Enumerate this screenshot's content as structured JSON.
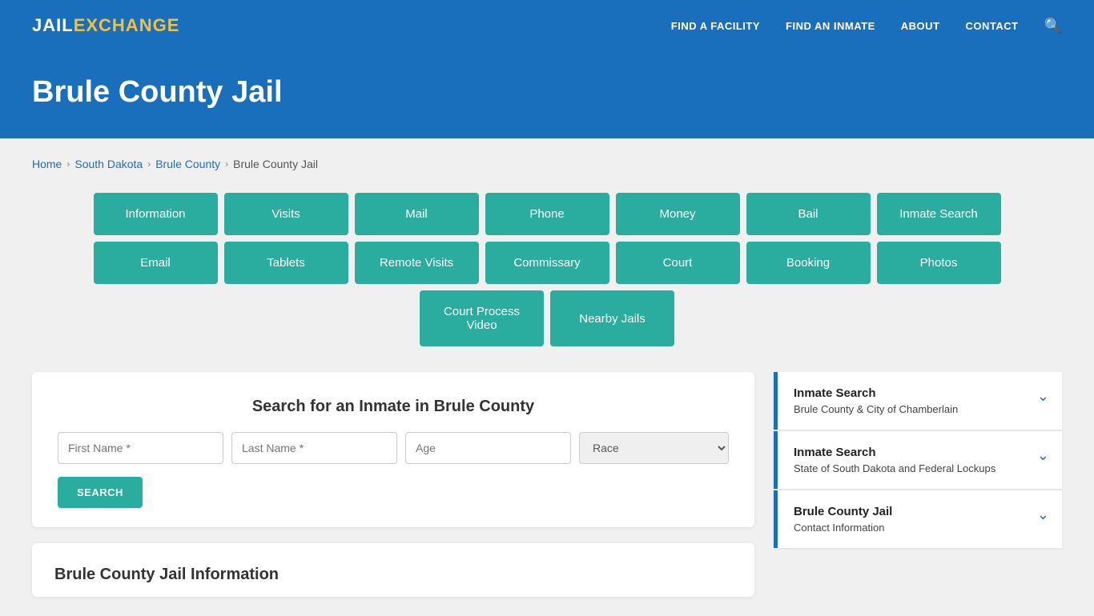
{
  "header": {
    "logo_jail": "JAIL",
    "logo_exchange": "EXCHANGE",
    "nav": [
      {
        "label": "FIND A FACILITY",
        "name": "find-facility"
      },
      {
        "label": "FIND AN INMATE",
        "name": "find-inmate"
      },
      {
        "label": "ABOUT",
        "name": "about"
      },
      {
        "label": "CONTACT",
        "name": "contact"
      }
    ]
  },
  "hero": {
    "title": "Brule County Jail"
  },
  "breadcrumb": {
    "items": [
      {
        "label": "Home",
        "name": "breadcrumb-home"
      },
      {
        "label": "South Dakota",
        "name": "breadcrumb-sd"
      },
      {
        "label": "Brule County",
        "name": "breadcrumb-county"
      },
      {
        "label": "Brule County Jail",
        "name": "breadcrumb-jail"
      }
    ]
  },
  "grid_buttons": {
    "row1": [
      {
        "label": "Information",
        "name": "btn-information"
      },
      {
        "label": "Visits",
        "name": "btn-visits"
      },
      {
        "label": "Mail",
        "name": "btn-mail"
      },
      {
        "label": "Phone",
        "name": "btn-phone"
      },
      {
        "label": "Money",
        "name": "btn-money"
      },
      {
        "label": "Bail",
        "name": "btn-bail"
      },
      {
        "label": "Inmate Search",
        "name": "btn-inmate-search"
      }
    ],
    "row2": [
      {
        "label": "Email",
        "name": "btn-email"
      },
      {
        "label": "Tablets",
        "name": "btn-tablets"
      },
      {
        "label": "Remote Visits",
        "name": "btn-remote-visits"
      },
      {
        "label": "Commissary",
        "name": "btn-commissary"
      },
      {
        "label": "Court",
        "name": "btn-court"
      },
      {
        "label": "Booking",
        "name": "btn-booking"
      },
      {
        "label": "Photos",
        "name": "btn-photos"
      }
    ],
    "row3": [
      {
        "label": "Court Process Video",
        "name": "btn-court-process-video"
      },
      {
        "label": "Nearby Jails",
        "name": "btn-nearby-jails"
      }
    ]
  },
  "search": {
    "title": "Search for an Inmate in Brule County",
    "first_name_placeholder": "First Name *",
    "last_name_placeholder": "Last Name *",
    "age_placeholder": "Age",
    "race_placeholder": "Race",
    "search_button": "SEARCH"
  },
  "info": {
    "title": "Brule County Jail Information"
  },
  "sidebar": {
    "cards": [
      {
        "title": "Inmate Search",
        "sub": "Brule County & City of Chamberlain",
        "name": "sidebar-inmate-search-local"
      },
      {
        "title": "Inmate Search",
        "sub": "State of South Dakota and Federal Lockups",
        "name": "sidebar-inmate-search-state"
      },
      {
        "title": "Brule County Jail",
        "sub": "Contact Information",
        "name": "sidebar-contact-info"
      }
    ]
  }
}
